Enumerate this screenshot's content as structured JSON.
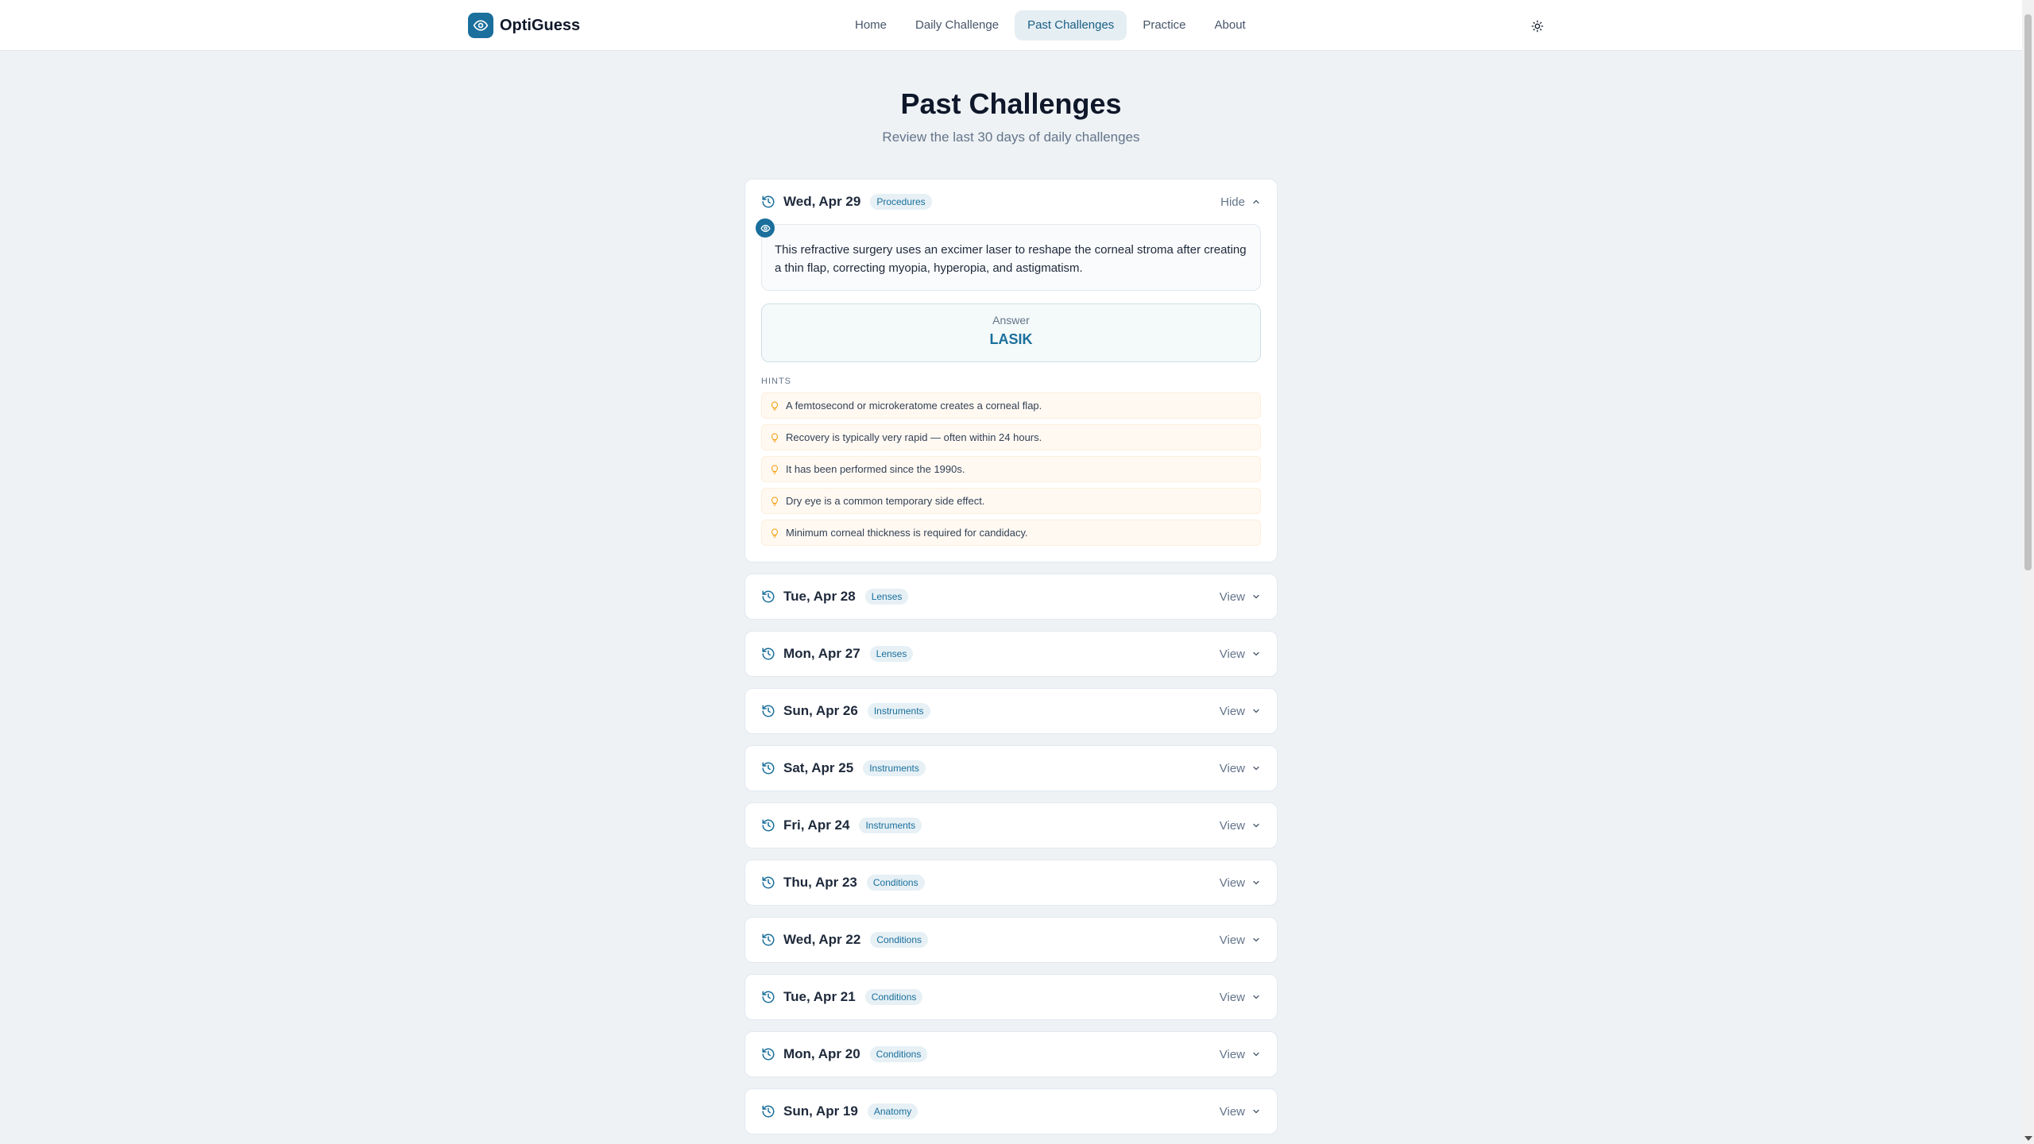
{
  "brand": {
    "name": "OptiGuess"
  },
  "nav": [
    {
      "label": "Home",
      "active": false
    },
    {
      "label": "Daily Challenge",
      "active": false
    },
    {
      "label": "Past Challenges",
      "active": true
    },
    {
      "label": "Practice",
      "active": false
    },
    {
      "label": "About",
      "active": false
    }
  ],
  "theme_toggle_icon": "sun-icon",
  "page": {
    "title": "Past Challenges",
    "subtitle": "Review the last 30 days of daily challenges"
  },
  "expanded": {
    "date": "Wed, Apr 29",
    "category": "Procedures",
    "toggle_label": "Hide",
    "question": "This refractive surgery uses an excimer laser to reshape the corneal stroma after creating a thin flap, correcting myopia, hyperopia, and astigmatism.",
    "answer_label": "Answer",
    "answer": "LASIK",
    "hints_label": "HINTS",
    "hints": [
      "A femtosecond or microkeratome creates a corneal flap.",
      "Recovery is typically very rapid — often within 24 hours.",
      "It has been performed since the 1990s.",
      "Dry eye is a common temporary side effect.",
      "Minimum corneal thickness is required for candidacy."
    ]
  },
  "collapsed": [
    {
      "date": "Tue, Apr 28",
      "category": "Lenses",
      "toggle_label": "View"
    },
    {
      "date": "Mon, Apr 27",
      "category": "Lenses",
      "toggle_label": "View"
    },
    {
      "date": "Sun, Apr 26",
      "category": "Instruments",
      "toggle_label": "View"
    },
    {
      "date": "Sat, Apr 25",
      "category": "Instruments",
      "toggle_label": "View"
    },
    {
      "date": "Fri, Apr 24",
      "category": "Instruments",
      "toggle_label": "View"
    },
    {
      "date": "Thu, Apr 23",
      "category": "Conditions",
      "toggle_label": "View"
    },
    {
      "date": "Wed, Apr 22",
      "category": "Conditions",
      "toggle_label": "View"
    },
    {
      "date": "Tue, Apr 21",
      "category": "Conditions",
      "toggle_label": "View"
    },
    {
      "date": "Mon, Apr 20",
      "category": "Conditions",
      "toggle_label": "View"
    },
    {
      "date": "Sun, Apr 19",
      "category": "Anatomy",
      "toggle_label": "View"
    }
  ],
  "colors": {
    "accent": "#1a6f9c",
    "page_bg": "#eef2f4",
    "hint_bg": "#fff9f2",
    "hint_icon": "#f59e0b"
  }
}
